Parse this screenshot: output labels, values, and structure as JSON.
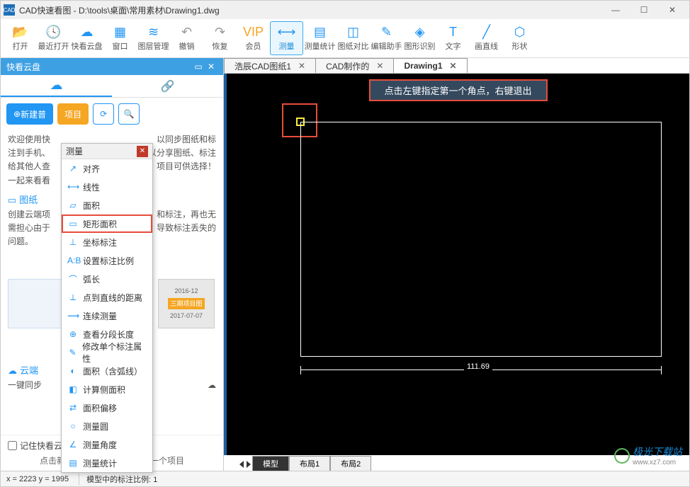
{
  "titlebar": {
    "app_icon_text": "CAD",
    "title": "CAD快速看图 - D:\\tools\\桌面\\常用素材\\Drawing1.dwg"
  },
  "toolbar": [
    {
      "label": "打开",
      "glyph": "📂"
    },
    {
      "label": "最近打开",
      "glyph": "🕓"
    },
    {
      "label": "快看云盘",
      "glyph": "☁"
    },
    {
      "label": "窗口",
      "glyph": "▦"
    },
    {
      "label": "图层管理",
      "glyph": "≋"
    },
    {
      "label": "撤销",
      "glyph": "↶"
    },
    {
      "label": "恢复",
      "glyph": "↷"
    },
    {
      "label": "会员",
      "glyph": "VIP"
    },
    {
      "label": "测量",
      "glyph": "⟷"
    },
    {
      "label": "测量统计",
      "glyph": "▤"
    },
    {
      "label": "图纸对比",
      "glyph": "◫"
    },
    {
      "label": "编辑助手",
      "glyph": "✎"
    },
    {
      "label": "图形识别",
      "glyph": "◈"
    },
    {
      "label": "文字",
      "glyph": "T"
    },
    {
      "label": "画直线",
      "glyph": "╱"
    },
    {
      "label": "形状",
      "glyph": "⬡"
    }
  ],
  "panel": {
    "title": "快看云盘",
    "new_btn": "新建普",
    "proj_btn": "项目",
    "welcome_lines": [
      "欢迎使用快",
      "注到手机、",
      "给其他人查",
      "一起来看看"
    ],
    "welcome_suffix": [
      "以同步图纸和标",
      "以分享图纸、标注",
      "项目可供选择！"
    ],
    "sect1_title": "图纸",
    "sect1_body": "创建云端项\n需担心由于\n问题。",
    "sect1_body_right": "和标注，再也无\n导致标注丢失的",
    "sect2_title": "云端",
    "sect2_body": "一键同步",
    "thumb_date1": "2016-12",
    "thumb_label": "三期项目图",
    "thumb_date2": "2017-07-07",
    "footer_chk": "记住快看云盘开启状态",
    "footer_hint": "点击新建项目按钮来创建您第一个项目"
  },
  "dropdown": {
    "title": "测量",
    "items": [
      {
        "label": "对齐",
        "ico": "↗"
      },
      {
        "label": "线性",
        "ico": "⟷"
      },
      {
        "label": "面积",
        "ico": "▱"
      },
      {
        "label": "矩形面积",
        "ico": "▭",
        "hl": true
      },
      {
        "label": "坐标标注",
        "ico": "⊥"
      },
      {
        "label": "设置标注比例",
        "ico": "A:B"
      },
      {
        "label": "弧长",
        "ico": "⌒"
      },
      {
        "label": "点到直线的距离",
        "ico": "⟂"
      },
      {
        "label": "连续测量",
        "ico": "⟿"
      },
      {
        "label": "查看分段长度",
        "ico": "⊕"
      },
      {
        "label": "修改单个标注属性",
        "ico": "✎"
      },
      {
        "label": "面积（含弧线）",
        "ico": "◐"
      },
      {
        "label": "计算侧面积",
        "ico": "◧"
      },
      {
        "label": "面积偏移",
        "ico": "⇄"
      },
      {
        "label": "测量圆",
        "ico": "○"
      },
      {
        "label": "测量角度",
        "ico": "∠"
      },
      {
        "label": "测量统计",
        "ico": "▤"
      }
    ]
  },
  "doc_tabs": [
    {
      "label": "浩辰CAD图纸1"
    },
    {
      "label": "CAD制作的"
    },
    {
      "label": "Drawing1",
      "active": true
    }
  ],
  "canvas": {
    "tooltip": "点击左键指定第一个角点，右键退出",
    "dimension": "111.69"
  },
  "layout_tabs": [
    {
      "label": "模型",
      "active": true
    },
    {
      "label": "布局1"
    },
    {
      "label": "布局2"
    }
  ],
  "status": {
    "coords": "x = 2223   y = 1995",
    "scale": "模型中的标注比例: 1"
  },
  "watermark": {
    "text": "极光下载站",
    "url": "www.xz7.com"
  }
}
